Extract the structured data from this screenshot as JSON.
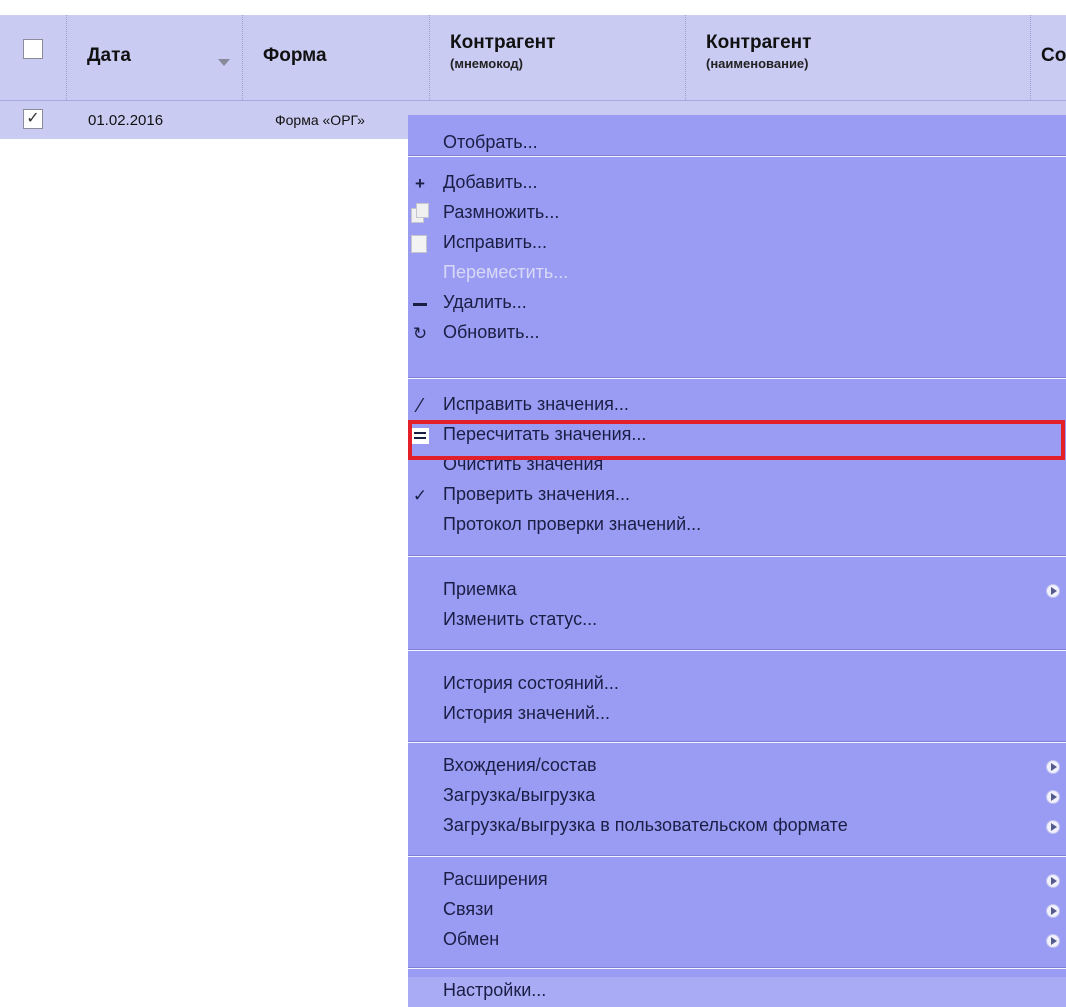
{
  "grid": {
    "columns": {
      "date": "Дата",
      "form": "Форма",
      "agent_code": "Контрагент",
      "agent_code_sub": "(мнемокод)",
      "agent_name": "Контрагент",
      "agent_name_sub": "(наименование)",
      "next_partial": "Со"
    },
    "row": {
      "checked": true,
      "date": "01.02.2016",
      "form": "Форма «ОРГ»"
    }
  },
  "menu": {
    "select": "Отобрать...",
    "add": "Добавить...",
    "duplicate": "Размножить...",
    "edit": "Исправить...",
    "move": "Переместить...",
    "delete": "Удалить...",
    "refresh": "Обновить...",
    "edit_values": "Исправить значения...",
    "recalc_values": "Пересчитать значения...",
    "clear_values": "Очистить значения",
    "check_values": "Проверить значения...",
    "check_log": "Протокол проверки значений...",
    "acceptance": "Приемка",
    "change_status": "Изменить статус...",
    "state_history": "История состояний...",
    "value_history": "История значений...",
    "entries": "Вхождения/состав",
    "load_unload": "Загрузка/выгрузка",
    "load_unload_user": "Загрузка/выгрузка в пользовательском формате",
    "extensions": "Расширения",
    "links": "Связи",
    "exchange": "Обмен",
    "settings": "Настройки..."
  },
  "highlight_color": "#e3202a",
  "menu_bg": "#9a9cf3",
  "header_bg": "#c9cbf2"
}
